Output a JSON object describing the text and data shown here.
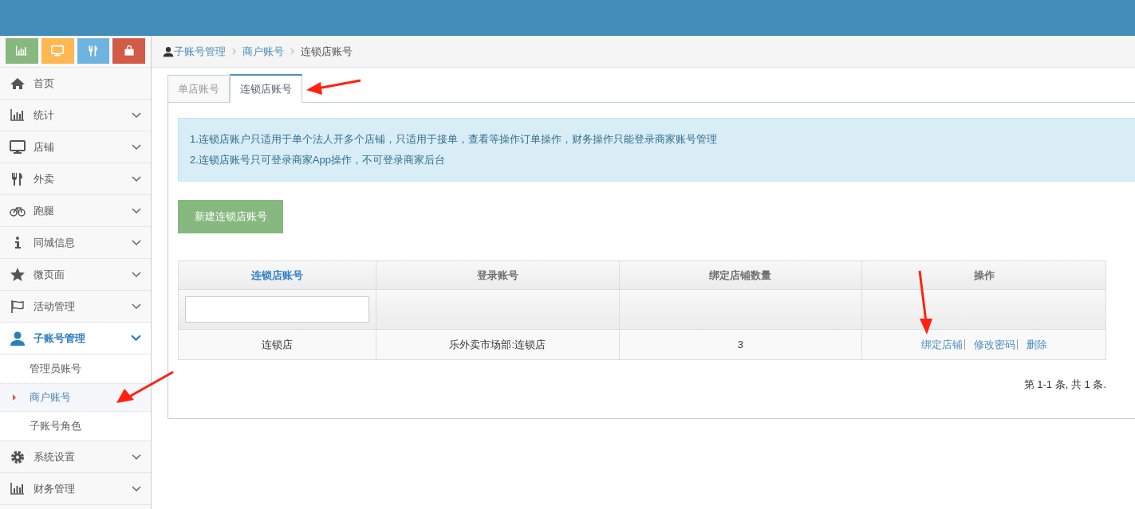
{
  "shortcuts": [
    {
      "kind": "chart",
      "color": "#87b87f"
    },
    {
      "kind": "monitor",
      "color": "#ffb752"
    },
    {
      "kind": "cutlery",
      "color": "#6fb3e0"
    },
    {
      "kind": "bag",
      "color": "#d15b47"
    }
  ],
  "sidebar": {
    "items": [
      {
        "kind": "home",
        "label": "首页",
        "selected": false
      },
      {
        "kind": "chart",
        "label": "统计",
        "expanded": false,
        "selected": false
      },
      {
        "kind": "monitor",
        "label": "店铺",
        "expanded": false,
        "selected": false
      },
      {
        "kind": "cutlery",
        "label": "外卖",
        "expanded": false,
        "selected": false
      },
      {
        "kind": "bike",
        "label": "跑腿",
        "expanded": false,
        "selected": false
      },
      {
        "kind": "info",
        "label": "同城信息",
        "expanded": false,
        "selected": false
      },
      {
        "kind": "star",
        "label": "微页面",
        "expanded": false,
        "selected": false
      },
      {
        "kind": "flag",
        "label": "活动管理",
        "expanded": false,
        "selected": false
      },
      {
        "kind": "user",
        "label": "子账号管理",
        "expanded": true,
        "selected": true,
        "children": [
          {
            "label": "管理员账号",
            "selected": false
          },
          {
            "label": "商户账号",
            "selected": true
          },
          {
            "label": "子账号角色",
            "selected": false
          }
        ]
      },
      {
        "kind": "gear",
        "label": "系统设置",
        "expanded": false,
        "selected": false
      },
      {
        "kind": "chart",
        "label": "财务管理",
        "expanded": false,
        "selected": false
      }
    ]
  },
  "breadcrumb": [
    {
      "label": "子账号管理",
      "link": true
    },
    {
      "label": "商户账号",
      "link": true
    },
    {
      "label": "连锁店账号",
      "link": false
    }
  ],
  "tabs": [
    {
      "label": "单店账号",
      "selected": false
    },
    {
      "label": "连锁店账号",
      "selected": true
    }
  ],
  "notice": [
    "1.连锁店账户只适用于单个法人开多个店铺，只适用于接单，查看等操作订单操作，财务操作只能登录商家账号管理",
    "2.连锁店账号只可登录商家App操作，不可登录商家后台"
  ],
  "create_button": "新建连锁店账号",
  "table": {
    "columns": [
      {
        "label": "连锁店账号",
        "sortable": true
      },
      {
        "label": "登录账号",
        "sortable": false
      },
      {
        "label": "绑定店铺数量",
        "sortable": false
      },
      {
        "label": "操作",
        "sortable": false
      }
    ],
    "filters": [
      {
        "kind": "input"
      },
      {
        "kind": "none"
      },
      {
        "kind": "none"
      },
      {
        "kind": "none"
      }
    ],
    "rows": [
      {
        "cells": [
          "连锁店",
          "乐外卖市场部:连锁店",
          "3"
        ],
        "actions": [
          "绑定店铺",
          "修改密码",
          "删除"
        ]
      }
    ]
  },
  "pagination": "第 1-1 条, 共 1 条."
}
